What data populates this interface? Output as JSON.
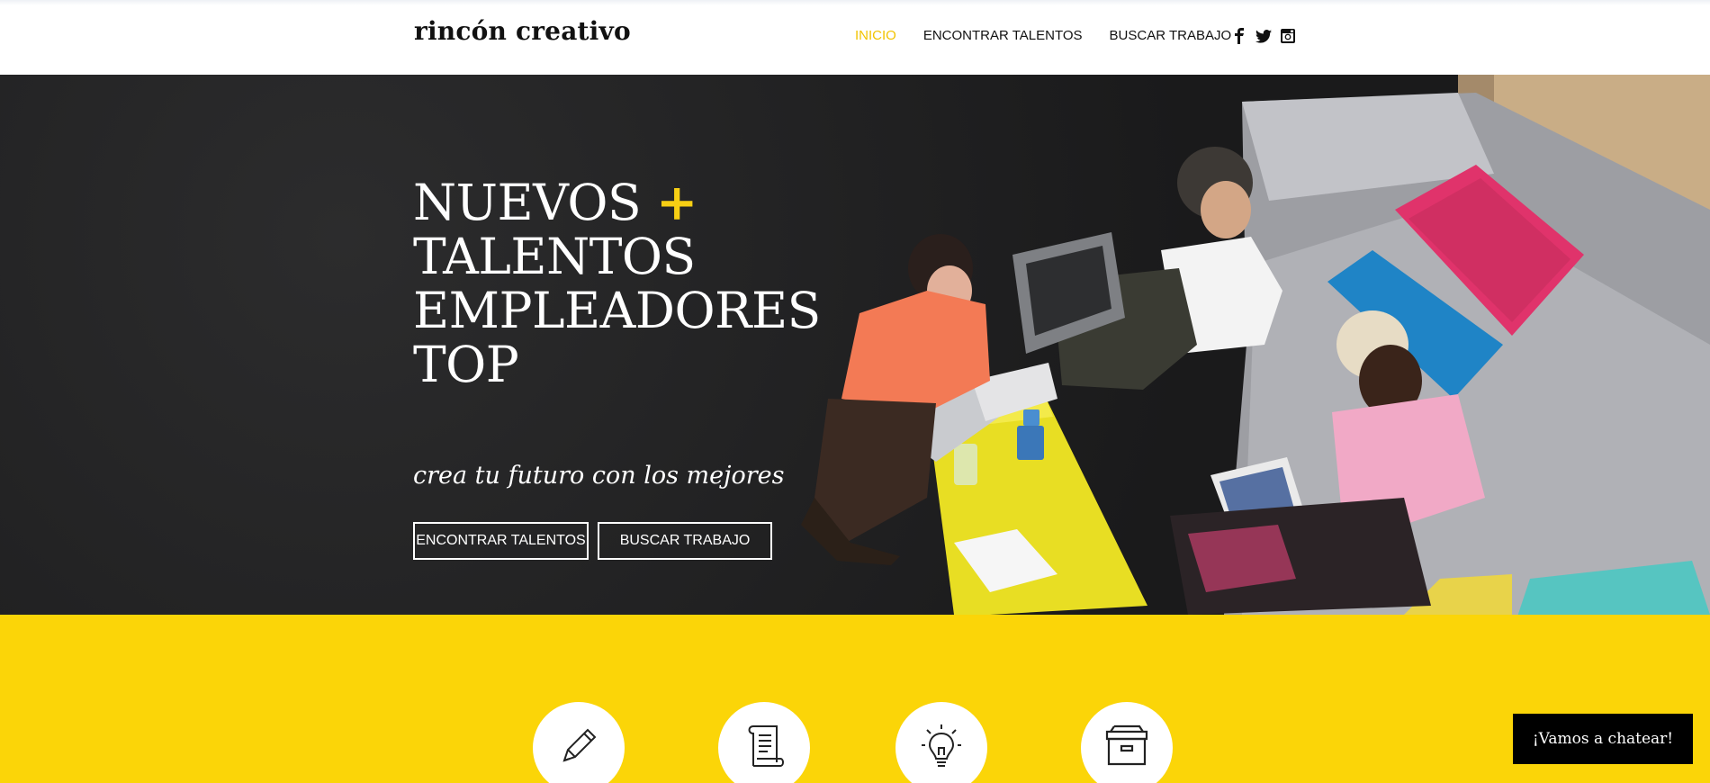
{
  "header": {
    "logo": "rincón creativo",
    "nav": {
      "home": "INICIO",
      "find_talent": "ENCONTRAR TALENTOS",
      "find_work": "BUSCAR TRABAJO"
    },
    "social": [
      "facebook-icon",
      "twitter-icon",
      "instagram-icon"
    ]
  },
  "hero": {
    "title_line1": "NUEVOS",
    "plus": "+",
    "title_line2": "TALENTOS",
    "title_line3": "EMPLEADORES",
    "title_line4": "TOP",
    "tagline": "crea tu futuro con los mejores",
    "button_talent": "ENCONTRAR TALENTOS",
    "button_work": "BUSCAR TRABAJO"
  },
  "features": {
    "icons": [
      "pencil-icon",
      "scroll-icon",
      "lightbulb-icon",
      "archive-box-icon"
    ]
  },
  "chat": {
    "label": "¡Vamos a chatear!"
  },
  "colors": {
    "accent": "#f2c300",
    "yellow_band": "#fbd508",
    "hero_bg": "#1d1d1e",
    "chat_bg": "#000000"
  }
}
